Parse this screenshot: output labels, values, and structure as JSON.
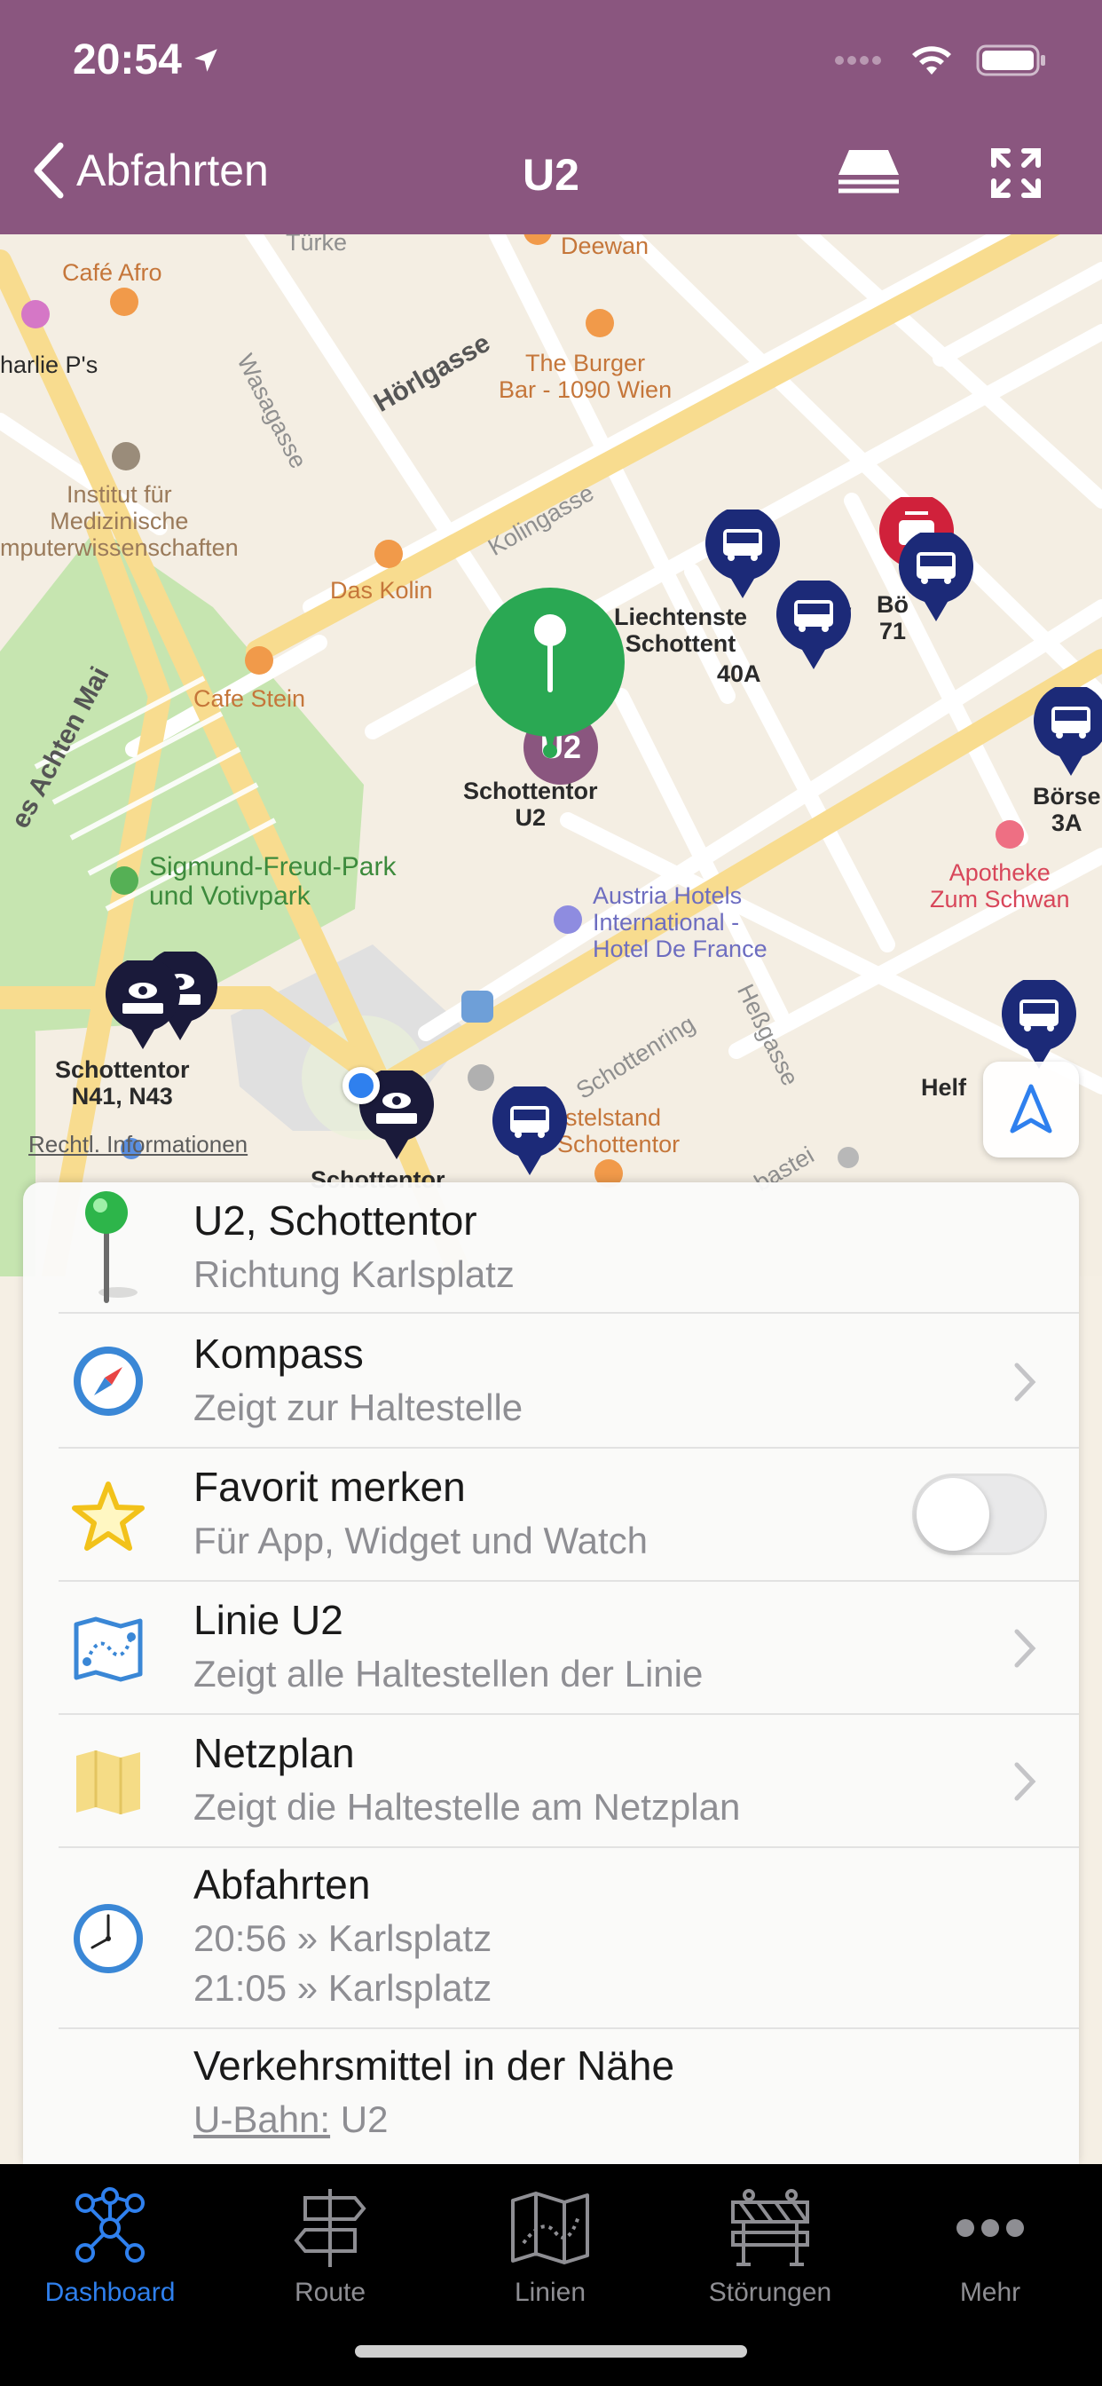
{
  "status": {
    "time": "20:54"
  },
  "header": {
    "back_label": "Abfahrten",
    "title": "U2"
  },
  "map": {
    "labels": {
      "cafe_afro": "Café Afro",
      "charlies": "harlie P's",
      "turkenstr": "Türke",
      "deewan": "Deewan",
      "wasagasse": "Wasagasse",
      "horlgasse": "Hörlgasse",
      "burger_bar": "The Burger\nBar - 1090 Wien",
      "institut": "Institut für\nMedizinische\nmputerwissenschaften",
      "kolingasse": "Kolingasse",
      "das_kolin": "Das Kolin",
      "cafe_stein": "Cafe Stein",
      "achten_mai": "es Achten Mai",
      "liechtenstein": "Liechtenste\nSchottent",
      "line_40a": "40A",
      "borse_71": "Bö\n71",
      "borse_3a": "Börse\n3A",
      "schottentor_u2": "Schottentor\nU2",
      "sigmund": "Sigmund-Freud-Park\nund Votivpark",
      "austria_hotels": "Austria Hotels\nInternational -\nHotel De France",
      "apotheke": "Apotheke\nZum Schwan",
      "schottenring": "Schottenring",
      "hessgasse": "Heßgasse",
      "schottentor_n41": "Schottentor\nN41, N43",
      "helf": "Helf",
      "taxistand": "rstelstand\nSchottentor",
      "schottentor_bottom": "Schottentor",
      "bastei": "bastei",
      "slash": "/",
      "u2_badge": "U2"
    },
    "legal_link": "Rechtl. Informationen"
  },
  "list": {
    "stop": {
      "title": "U2, Schottentor",
      "subtitle": "Richtung Karlsplatz",
      "icon": "green-pin-icon"
    },
    "compass": {
      "title": "Kompass",
      "subtitle": "Zeigt zur Haltestelle",
      "icon": "compass-icon"
    },
    "favorite": {
      "title": "Favorit merken",
      "subtitle": "Für App, Widget und Watch",
      "icon": "star-icon",
      "enabled": false
    },
    "line": {
      "title": "Linie U2",
      "subtitle": "Zeigt alle Haltestellen der Linie",
      "icon": "line-map-icon"
    },
    "netzplan": {
      "title": "Netzplan",
      "subtitle": "Zeigt die Haltestelle am Netzplan",
      "icon": "folded-map-icon"
    },
    "departures": {
      "title": "Abfahrten",
      "icon": "clock-icon",
      "times": [
        "20:56 » Karlsplatz",
        "21:05 » Karlsplatz"
      ]
    },
    "nearby": {
      "title": "Verkehrsmittel in der Nähe",
      "mode_label": "U-Bahn:",
      "lines": "U2"
    }
  },
  "tabs": [
    {
      "label": "Dashboard",
      "icon": "network-icon",
      "active": true
    },
    {
      "label": "Route",
      "icon": "signpost-icon",
      "active": false
    },
    {
      "label": "Linien",
      "icon": "route-map-icon",
      "active": false
    },
    {
      "label": "Störungen",
      "icon": "barrier-icon",
      "active": false
    },
    {
      "label": "Mehr",
      "icon": "more-dots-icon",
      "active": false
    }
  ],
  "colors": {
    "header": "#8a567f",
    "bus_pin": "#1c2a78",
    "tram_pin": "#d0213b",
    "selected_pin": "#2aa853",
    "active_tab": "#2f80ee"
  }
}
